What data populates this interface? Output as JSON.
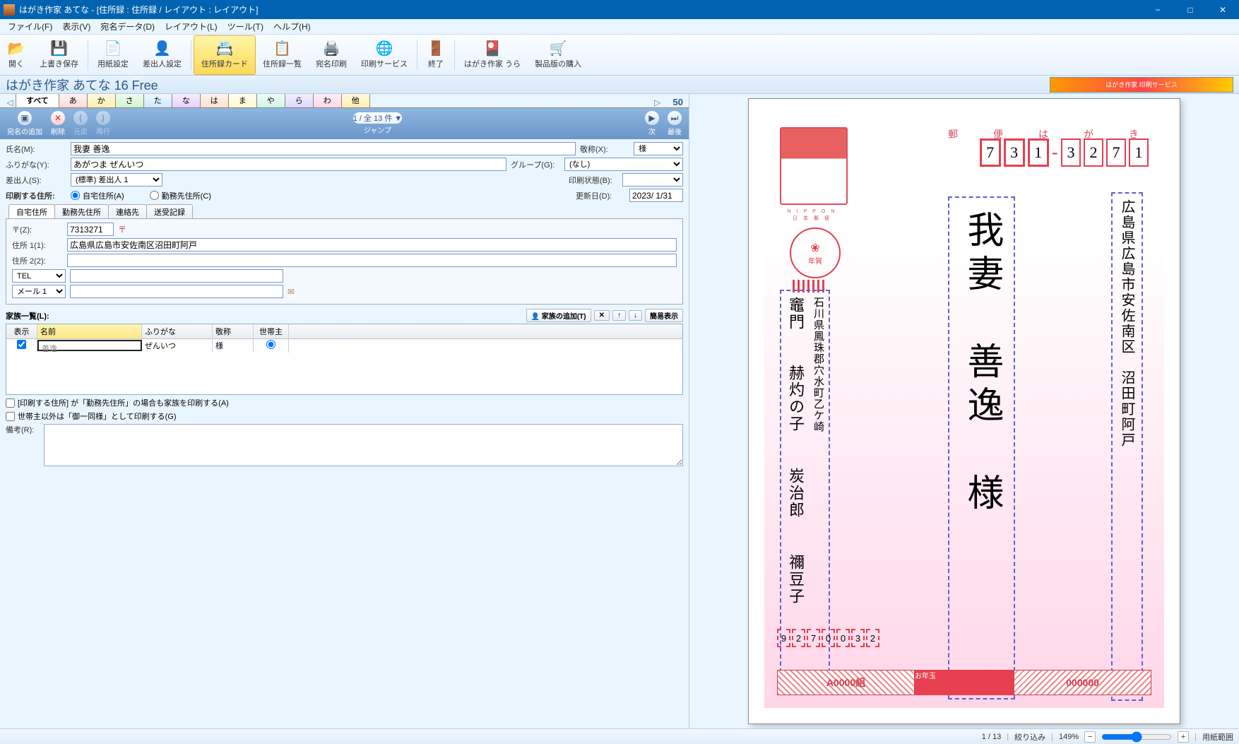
{
  "window": {
    "title": "はがき作家 あてな - [住所録 : 住所録 / レイアウト : レイアウト]"
  },
  "menubar": [
    "ファイル(F)",
    "表示(V)",
    "宛名データ(D)",
    "レイアウト(L)",
    "ツール(T)",
    "ヘルプ(H)"
  ],
  "toolbar": {
    "open": "開く",
    "save": "上書き保存",
    "paper": "用紙設定",
    "sender": "差出人設定",
    "card": "住所録カード",
    "list": "住所録一覧",
    "print": "宛名印刷",
    "service": "印刷サービス",
    "exit": "終了",
    "flip": "はがき作家 うら",
    "buy": "製品版の購入"
  },
  "app_title": "はがき作家 あてな 16 Free",
  "index_tabs": {
    "all": "すべて",
    "a": "あ",
    "ka": "か",
    "sa": "さ",
    "ta": "た",
    "na": "な",
    "ha": "は",
    "ma": "ま",
    "ya": "や",
    "ra": "ら",
    "wa": "わ",
    "other": "他",
    "count": "50"
  },
  "navbar": {
    "add": "宛名の追加",
    "del": "削除",
    "undo": "元戻",
    "redo": "再行",
    "jump_text": "1 / 全 13 件 ▼",
    "jump_label": "ジャンプ",
    "next": "次",
    "last": "最後"
  },
  "form": {
    "name_label": "氏名(M):",
    "name_value": "我妻 善逸",
    "furigana_label": "ふりがな(Y):",
    "furigana_value": "あがつま ぜんいつ",
    "sender_label": "差出人(S):",
    "sender_value": "(標準) 差出人 1",
    "printaddr_label": "印刷する住所:",
    "home_radio": "自宅住所(A)",
    "work_radio": "勤務先住所(C)",
    "honorific_label": "敬称(X):",
    "honorific_value": "様",
    "group_label": "グループ(G):",
    "group_value": "(なし)",
    "printstatus_label": "印刷状態(B):",
    "printstatus_value": "",
    "updated_label": "更新日(D):",
    "updated_value": "2023/ 1/31"
  },
  "detail_tabs": [
    "自宅住所",
    "勤務先住所",
    "連絡先",
    "送受記録"
  ],
  "address": {
    "zip_label": "〒(Z):",
    "zip_value": "7313271",
    "addr1_label": "住所 1(1):",
    "addr1_value": "広島県広島市安佐南区沼田町阿戸",
    "addr2_label": "住所 2(2):",
    "addr2_value": "",
    "tel_label": "TEL",
    "tel_value": "",
    "mail_label": "メール 1",
    "mail_value": ""
  },
  "family": {
    "header": "家族一覧(L):",
    "add_btn": "家族の追加(T)",
    "simple_btn": "簡易表示",
    "cols": {
      "disp": "表示",
      "name": "名前",
      "furigana": "ふりがな",
      "honorific": "敬称",
      "head": "世帯主"
    },
    "row": {
      "name": "善逸",
      "furigana": "ぜんいつ",
      "honorific": "様"
    }
  },
  "options": {
    "work_family": "[印刷する住所] が「勤務先住所」の場合も家族を印刷する(A)",
    "goichido": "世帯主以外は「御一同様」として印刷する(G)",
    "remarks_label": "備考(R):"
  },
  "postcard": {
    "top": "郵　便　は　が　き",
    "nippon": "NIPPON　　日本郵便",
    "seal": "年賀",
    "zip": [
      "7",
      "3",
      "1",
      "3",
      "2",
      "7",
      "1"
    ],
    "address": "広島県広島市安佐南区　沼田町阿戸",
    "name": "我妻　善逸　様",
    "sender_addr": "石川県鳳珠郡穴水町乙ケ崎",
    "sender_names": [
      "竈門　　赫灼の子",
      "　　炭治郎",
      "　　禰豆子"
    ],
    "sender_zip": [
      "9",
      "2",
      "7",
      "0",
      "0",
      "3",
      "2"
    ],
    "footer_left": "A0000組",
    "footer_mid": "お年玉",
    "footer_right": "000000"
  },
  "status": {
    "pos": "1 / 13",
    "filter": "絞り込み",
    "zoom": "149%",
    "rangebtn": "用紙範囲"
  }
}
